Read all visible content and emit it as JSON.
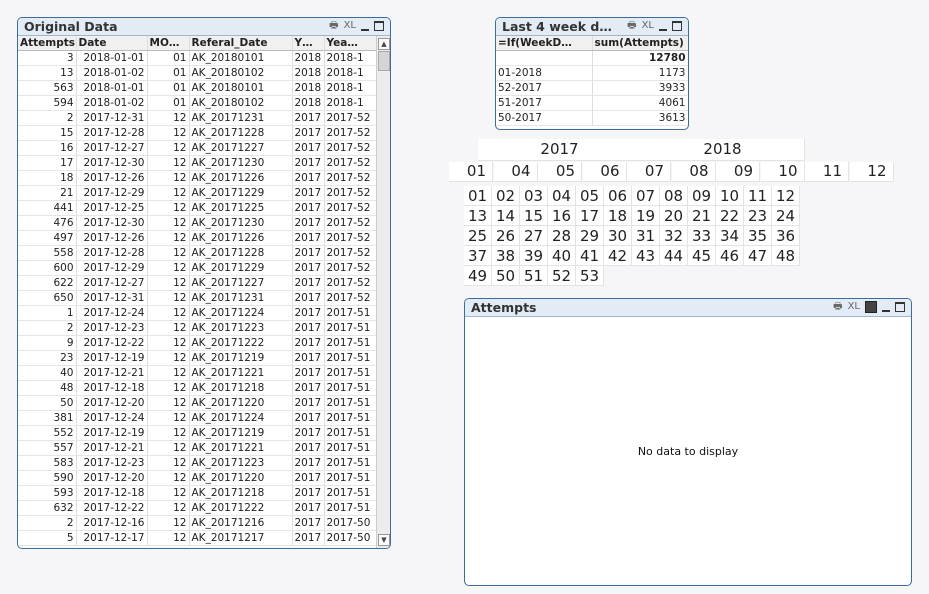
{
  "original_data": {
    "title": "Original Data",
    "icons": {
      "print": "printer-icon",
      "xl": "XL"
    },
    "columns": [
      "Attempts",
      "Date",
      "MO…",
      "Referal_Date",
      "Y…",
      "Yea…"
    ],
    "rows": [
      [
        "3",
        "2018-01-01",
        "01",
        "AK_20180101",
        "2018",
        "2018-1"
      ],
      [
        "13",
        "2018-01-02",
        "01",
        "AK_20180102",
        "2018",
        "2018-1"
      ],
      [
        "563",
        "2018-01-01",
        "01",
        "AK_20180101",
        "2018",
        "2018-1"
      ],
      [
        "594",
        "2018-01-02",
        "01",
        "AK_20180102",
        "2018",
        "2018-1"
      ],
      [
        "2",
        "2017-12-31",
        "12",
        "AK_20171231",
        "2017",
        "2017-52"
      ],
      [
        "15",
        "2017-12-28",
        "12",
        "AK_20171228",
        "2017",
        "2017-52"
      ],
      [
        "16",
        "2017-12-27",
        "12",
        "AK_20171227",
        "2017",
        "2017-52"
      ],
      [
        "17",
        "2017-12-30",
        "12",
        "AK_20171230",
        "2017",
        "2017-52"
      ],
      [
        "18",
        "2017-12-26",
        "12",
        "AK_20171226",
        "2017",
        "2017-52"
      ],
      [
        "21",
        "2017-12-29",
        "12",
        "AK_20171229",
        "2017",
        "2017-52"
      ],
      [
        "441",
        "2017-12-25",
        "12",
        "AK_20171225",
        "2017",
        "2017-52"
      ],
      [
        "476",
        "2017-12-30",
        "12",
        "AK_20171230",
        "2017",
        "2017-52"
      ],
      [
        "497",
        "2017-12-26",
        "12",
        "AK_20171226",
        "2017",
        "2017-52"
      ],
      [
        "558",
        "2017-12-28",
        "12",
        "AK_20171228",
        "2017",
        "2017-52"
      ],
      [
        "600",
        "2017-12-29",
        "12",
        "AK_20171229",
        "2017",
        "2017-52"
      ],
      [
        "622",
        "2017-12-27",
        "12",
        "AK_20171227",
        "2017",
        "2017-52"
      ],
      [
        "650",
        "2017-12-31",
        "12",
        "AK_20171231",
        "2017",
        "2017-52"
      ],
      [
        "1",
        "2017-12-24",
        "12",
        "AK_20171224",
        "2017",
        "2017-51"
      ],
      [
        "2",
        "2017-12-23",
        "12",
        "AK_20171223",
        "2017",
        "2017-51"
      ],
      [
        "9",
        "2017-12-22",
        "12",
        "AK_20171222",
        "2017",
        "2017-51"
      ],
      [
        "23",
        "2017-12-19",
        "12",
        "AK_20171219",
        "2017",
        "2017-51"
      ],
      [
        "40",
        "2017-12-21",
        "12",
        "AK_20171221",
        "2017",
        "2017-51"
      ],
      [
        "48",
        "2017-12-18",
        "12",
        "AK_20171218",
        "2017",
        "2017-51"
      ],
      [
        "50",
        "2017-12-20",
        "12",
        "AK_20171220",
        "2017",
        "2017-51"
      ],
      [
        "381",
        "2017-12-24",
        "12",
        "AK_20171224",
        "2017",
        "2017-51"
      ],
      [
        "552",
        "2017-12-19",
        "12",
        "AK_20171219",
        "2017",
        "2017-51"
      ],
      [
        "557",
        "2017-12-21",
        "12",
        "AK_20171221",
        "2017",
        "2017-51"
      ],
      [
        "583",
        "2017-12-23",
        "12",
        "AK_20171223",
        "2017",
        "2017-51"
      ],
      [
        "590",
        "2017-12-20",
        "12",
        "AK_20171220",
        "2017",
        "2017-51"
      ],
      [
        "593",
        "2017-12-18",
        "12",
        "AK_20171218",
        "2017",
        "2017-51"
      ],
      [
        "632",
        "2017-12-22",
        "12",
        "AK_20171222",
        "2017",
        "2017-51"
      ],
      [
        "2",
        "2017-12-16",
        "12",
        "AK_20171216",
        "2017",
        "2017-50"
      ],
      [
        "5",
        "2017-12-17",
        "12",
        "AK_20171217",
        "2017",
        "2017-50"
      ]
    ]
  },
  "last4": {
    "title": "Last 4 week d…",
    "columns": [
      "=If(WeekD…",
      "sum(Attempts)"
    ],
    "total": "12780",
    "rows": [
      [
        "01-2018",
        "1173"
      ],
      [
        "52-2017",
        "3933"
      ],
      [
        "51-2017",
        "4061"
      ],
      [
        "50-2017",
        "3613"
      ]
    ]
  },
  "years": [
    "2017",
    "2018"
  ],
  "months": [
    "01",
    "04",
    "05",
    "06",
    "07",
    "08",
    "09",
    "10",
    "11",
    "12"
  ],
  "weeks": [
    "01",
    "02",
    "03",
    "04",
    "05",
    "06",
    "07",
    "08",
    "09",
    "10",
    "11",
    "12",
    "13",
    "14",
    "15",
    "16",
    "17",
    "18",
    "19",
    "20",
    "21",
    "22",
    "23",
    "24",
    "25",
    "26",
    "27",
    "28",
    "29",
    "30",
    "31",
    "32",
    "33",
    "34",
    "35",
    "36",
    "37",
    "38",
    "39",
    "40",
    "41",
    "42",
    "43",
    "44",
    "45",
    "46",
    "47",
    "48",
    "49",
    "50",
    "51",
    "52",
    "53"
  ],
  "attempts_chart": {
    "title": "Attempts",
    "empty_text": "No data to display"
  }
}
